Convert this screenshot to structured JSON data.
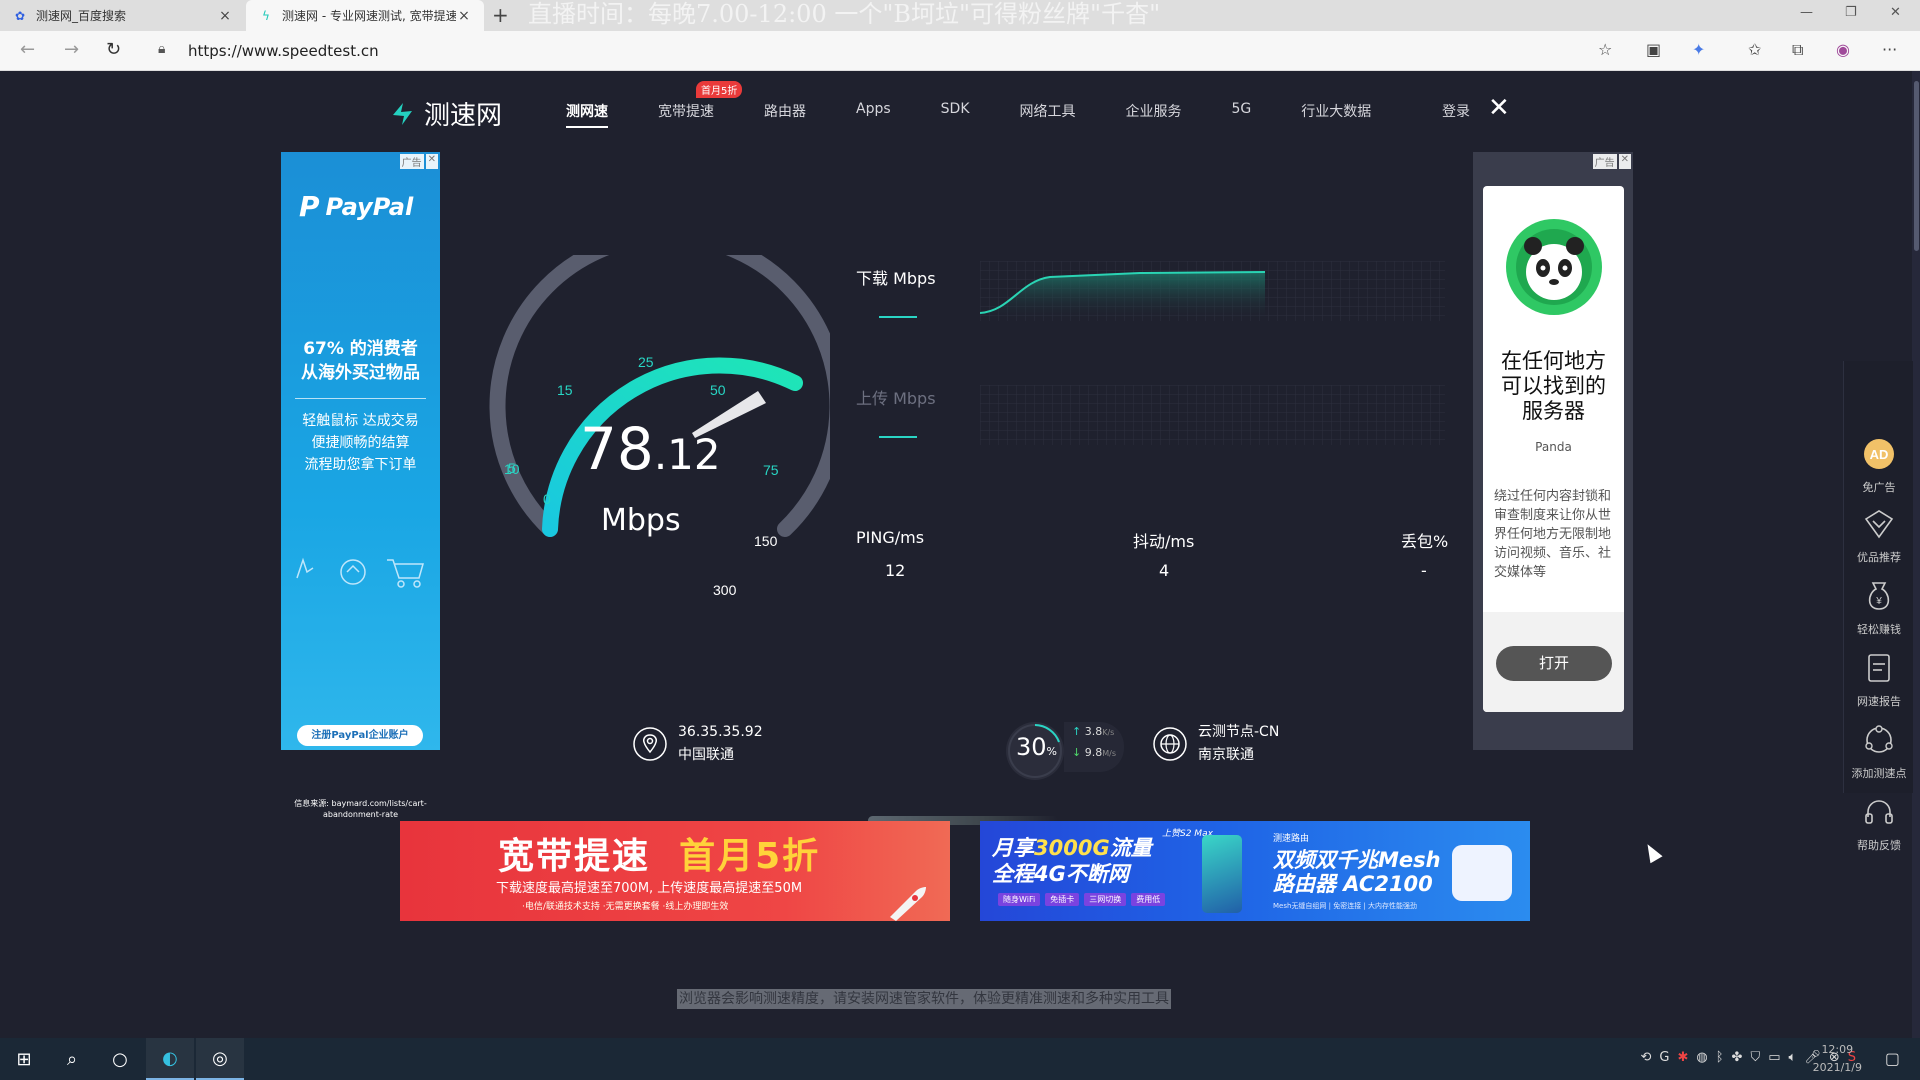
{
  "browser": {
    "tabs": [
      {
        "title": "测速网_百度搜索",
        "active": false
      },
      {
        "title": "测速网 - 专业网速测试, 宽带提速",
        "active": true
      }
    ],
    "marquee": "直播时间：每晚7.00-12:00 一个\"B坷垃\"可得粉丝牌\"千杳\"",
    "url": "https://www.speedtest.cn"
  },
  "site": {
    "logo_text": "测速网",
    "nav": [
      "测网速",
      "宽带提速",
      "路由器",
      "Apps",
      "SDK",
      "网络工具",
      "企业服务",
      "5G",
      "行业大数据"
    ],
    "nav_badge": "首月5折",
    "login": "登录"
  },
  "ad_left": {
    "tag": "广告",
    "brand": "PayPal",
    "headline_1": "67% 的消费者",
    "headline_2": "从海外买过物品",
    "body_1": "轻触鼠标 达成交易",
    "body_2": "便捷顺畅的结算",
    "body_3": "流程助您拿下订单",
    "button": "注册PayPal企业账户",
    "source_1": "信息来源: baymard.com/lists/cart-",
    "source_2": "abandonment-rate"
  },
  "gauge": {
    "speed_int": "78",
    "speed_dec": ".12",
    "unit": "Mbps",
    "ticks": [
      "0",
      "5",
      "10",
      "15",
      "25",
      "50",
      "75",
      "150",
      "300"
    ],
    "accent": "#14d9c6"
  },
  "download": {
    "label": "下载 Mbps"
  },
  "upload": {
    "label": "上传 Mbps"
  },
  "stats": {
    "ping_label": "PING/ms",
    "ping_value": "12",
    "jitter_label": "抖动/ms",
    "jitter_value": "4",
    "loss_label": "丢包%",
    "loss_value": "-"
  },
  "progress": {
    "percent": "30",
    "pct_sign": "%",
    "up_rate": "3.8",
    "up_unit": "K/s",
    "down_rate": "9.8",
    "down_unit": "M/s"
  },
  "client": {
    "ip": "36.35.35.92",
    "isp": "中国联通"
  },
  "server": {
    "name": "云测节点-CN",
    "isp": "南京联通"
  },
  "ad_right": {
    "tag": "广告",
    "title_1": "在任何地方",
    "title_2": "可以找到的",
    "title_3": "服务器",
    "app": "Panda",
    "desc": "绕过任何内容封锁和审查制度来让你从世界任何地方无限制地访问视频、音乐、社交媒体等",
    "button": "打开"
  },
  "sidebar": [
    {
      "icon": "ad-icon",
      "label": "免广告"
    },
    {
      "icon": "recommend-icon",
      "label": "优品推荐"
    },
    {
      "icon": "money-icon",
      "label": "轻松赚钱"
    },
    {
      "icon": "report-icon",
      "label": "网速报告"
    },
    {
      "icon": "add-node-icon",
      "label": "添加测速点"
    },
    {
      "icon": "headset-icon",
      "label": "帮助反馈"
    }
  ],
  "banner_broadband": {
    "title_a": "宽带提速",
    "title_b": "首月5折",
    "line": "下载速度最高提速至700M, 上传速度最高提速至50M",
    "small": "·电信/联通技术支持  ·无需更换套餐  ·线上办理即生效"
  },
  "banner_router": {
    "line1_a": "月享",
    "line1_b": "3000G",
    "line1_c": "流量",
    "line2": "全程4G不断网",
    "tags": [
      "随身WiFi",
      "免插卡",
      "三网切换",
      "费用低"
    ],
    "model": "上赞S2 Max",
    "brand": "测速路由",
    "line3": "双频双千兆Mesh",
    "line4": "路由器 AC2100",
    "sub": "Mesh无缝自组网 | 免密连接 | 大内存性能强劲"
  },
  "notice": "浏览器会影响测速精度，请安装网速管家软件，体验更精准测速和多种实用工具",
  "taskbar": {
    "time": "12:09",
    "date": "2021/1/9"
  }
}
